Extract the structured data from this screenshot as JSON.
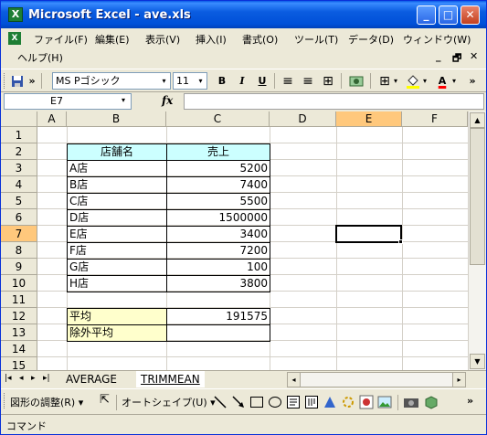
{
  "window": {
    "title": "Microsoft Excel - ave.xls",
    "minimize_label": "_",
    "maximize_label": "□",
    "close_label": "✕",
    "app_icon_label": "X"
  },
  "menubar": {
    "items": [
      "ファイル(F)",
      "編集(E)",
      "表示(V)",
      "挿入(I)",
      "書式(O)",
      "ツール(T)",
      "データ(D)",
      "ウィンドウ(W)",
      "ヘルプ(H)"
    ],
    "doc_controls": [
      "_",
      "🗗",
      "✕"
    ]
  },
  "toolbar": {
    "save_icon": "disk-icon",
    "more": "»",
    "font_name": "MS Pゴシック",
    "font_size": "11",
    "bold": "B",
    "italic": "I",
    "underline": "U",
    "align_left": "≡",
    "align_center": "≡",
    "merge_center": "⊞",
    "currency": "💱",
    "borders": "⊞",
    "fill_color_icon": "paint-bucket-icon",
    "font_color": "A",
    "dropdown_arrow": "▾",
    "fill_color": "#ffff00",
    "font_color_value": "#ff0000"
  },
  "formula_bar": {
    "name_box": "E7",
    "fx": "fx",
    "formula": ""
  },
  "sheet": {
    "columns": [
      "A",
      "B",
      "C",
      "D",
      "E",
      "F"
    ],
    "selected_column": "E",
    "rows": [
      "1",
      "2",
      "3",
      "4",
      "5",
      "6",
      "7",
      "8",
      "9",
      "10",
      "11",
      "12",
      "13",
      "14",
      "15"
    ],
    "selected_row": "7",
    "header_shop": "店舗名",
    "header_sales": "売上",
    "stores": [
      {
        "name": "A店",
        "sales": "5200"
      },
      {
        "name": "B店",
        "sales": "7400"
      },
      {
        "name": "C店",
        "sales": "5500"
      },
      {
        "name": "D店",
        "sales": "1500000"
      },
      {
        "name": "E店",
        "sales": "3400"
      },
      {
        "name": "F店",
        "sales": "7200"
      },
      {
        "name": "G店",
        "sales": "100"
      },
      {
        "name": "H店",
        "sales": "3800"
      }
    ],
    "average_label": "平均",
    "average_value": "191575",
    "trimmed_label": "除外平均",
    "trimmed_value": "",
    "header_fill": "#ccffff",
    "label_fill": "#ffffcc"
  },
  "tabs": {
    "nav": [
      "|◂",
      "◂",
      "▸",
      "▸|"
    ],
    "sheets": [
      "AVERAGE",
      "TRIMMEAN"
    ],
    "active": "TRIMMEAN"
  },
  "drawing": {
    "draw_menu": "図形の調整(R) ▾",
    "autoshape_menu": "オートシェイプ(U) ▾",
    "tools": [
      "cursor-icon",
      "line-icon",
      "arrow-icon",
      "rectangle-icon",
      "oval-icon",
      "textbox-icon",
      "vertical-textbox-icon",
      "wordart-icon",
      "diagram-icon",
      "clipart-icon",
      "picture-icon",
      "camera-icon",
      "3d-icon"
    ]
  },
  "status": {
    "mode": "コマンド"
  }
}
